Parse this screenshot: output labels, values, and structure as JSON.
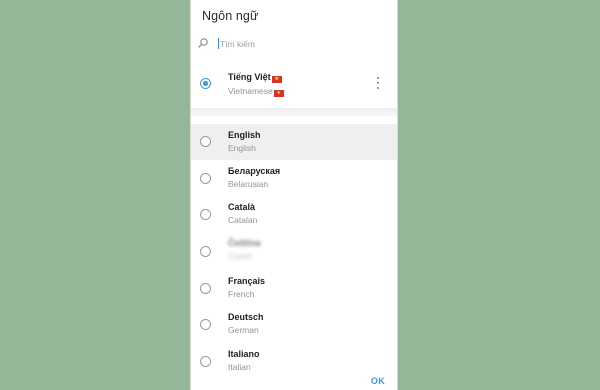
{
  "dialog": {
    "title": "Ngôn ngữ"
  },
  "search": {
    "placeholder": "Tìm kiếm",
    "icon": "search-icon"
  },
  "current": {
    "name": "Tiếng Việt",
    "sub": "Vietnamese",
    "flag": "vietnam-flag",
    "selected": true
  },
  "languages": [
    {
      "name": "English",
      "sub": "English"
    },
    {
      "name": "Беларуская",
      "sub": "Belarusian"
    },
    {
      "name": "Català",
      "sub": "Catalan"
    },
    {
      "name": "Čeština",
      "sub": "Czech"
    },
    {
      "name": "Français",
      "sub": "French"
    },
    {
      "name": "Deutsch",
      "sub": "German"
    },
    {
      "name": "Italiano",
      "sub": "Italian"
    }
  ],
  "footer": {
    "ok_label": "OK"
  },
  "colors": {
    "accent": "#3d9ad8",
    "background": "#94b897"
  }
}
